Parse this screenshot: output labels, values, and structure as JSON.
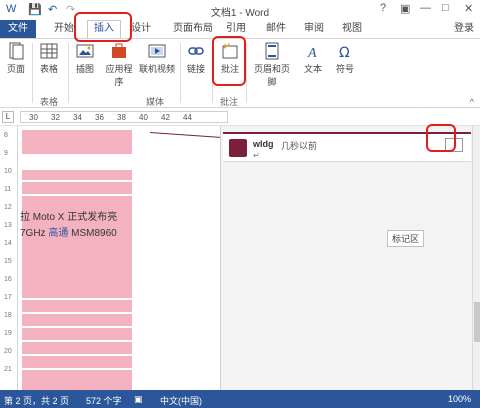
{
  "title_bar": {
    "title": "文档1 - Word",
    "help": "?",
    "restore_ribbon": "▣",
    "minimize": "—",
    "maximize": "□",
    "close": "✕",
    "quick_access": {
      "save": "💾",
      "undo": "↶",
      "redo": "↷"
    }
  },
  "tabs": {
    "file": "文件",
    "items": [
      "开始",
      "插入",
      "设计",
      "页面布局",
      "引用",
      "邮件",
      "审阅",
      "视图"
    ],
    "active": "插入",
    "login": "登录"
  },
  "ribbon": {
    "buttons": {
      "pages": "页面",
      "table": "表格",
      "illustrations": "插图",
      "apps": "应用程序",
      "online_video": "联机视频",
      "links": "链接",
      "comment": "批注",
      "header_footer": "页眉和页脚",
      "text": "文本",
      "symbols": "符号"
    },
    "groups": {
      "tables": "表格",
      "media": "媒体",
      "comments": "批注"
    },
    "collapse": "^"
  },
  "ruler": {
    "ticks": [
      "30",
      "32",
      "34",
      "36",
      "38",
      "40",
      "42",
      "44"
    ]
  },
  "document": {
    "line1": "拉 Moto X 正式发布亮",
    "line2_prefix": "7GHz ",
    "line2_link": "高通",
    "line2_suffix": " MSM8960",
    "vertical_ruler": [
      "8",
      "9",
      "10",
      "11",
      "12",
      "13",
      "14",
      "15",
      "16",
      "17",
      "18",
      "19",
      "20",
      "21"
    ]
  },
  "markup_pane": {
    "comment_author": "wldg",
    "comment_time": "几秒以前",
    "comment_return": "↵",
    "tooltip": "标记区"
  },
  "status_bar": {
    "page": "第 2 页，共 2 页",
    "words": "572 个字",
    "language": "中文(中国)",
    "zoom": "100%"
  },
  "colors": {
    "accent": "#2b579a",
    "highlight": "#f4b1c0",
    "comment_color": "#7b1f3a",
    "annotation_ring": "#e02020"
  }
}
